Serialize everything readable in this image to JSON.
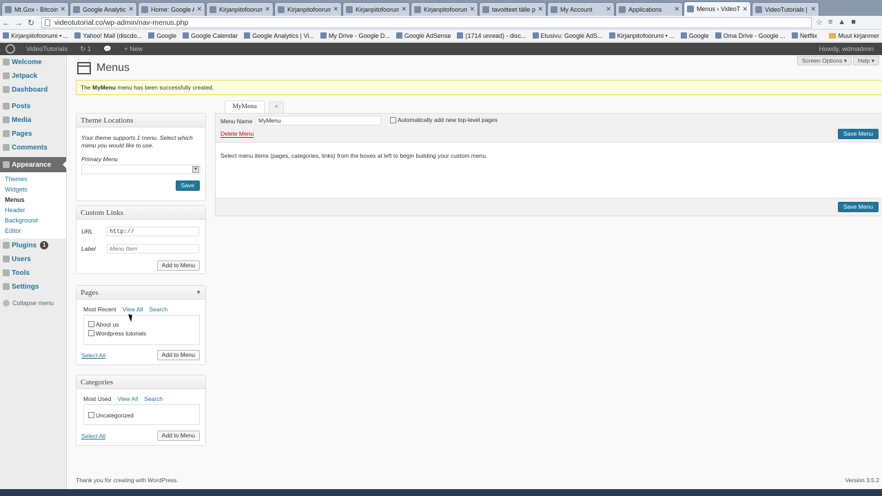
{
  "browser": {
    "tabs": [
      {
        "label": "Mt.Gox - Bitcoin",
        "active": false
      },
      {
        "label": "Google Analytics",
        "active": false
      },
      {
        "label": "Home: Google A",
        "active": false
      },
      {
        "label": "Kirjanpitofoorum",
        "active": false
      },
      {
        "label": "Kirjanpitofoorum",
        "active": false
      },
      {
        "label": "Kirjanpitofoorum",
        "active": false
      },
      {
        "label": "Kirjanpitofoorum",
        "active": false
      },
      {
        "label": "tavoitteet tälle pa",
        "active": false
      },
      {
        "label": "My Account",
        "active": false
      },
      {
        "label": "Applications",
        "active": false
      },
      {
        "label": "Menus ‹ VideoTu",
        "active": true
      },
      {
        "label": "VideoTutorials | J",
        "active": false
      }
    ],
    "url": "videotutorial.co/wp-admin/nav-menus.php",
    "bookmarks": [
      "Kirjanpitofoorumi • ...",
      "Yahoo! Mail (discdo...",
      "Google",
      "Google Calendar",
      "Google Analytics | Vi...",
      "My Drive - Google D...",
      "Google AdSense",
      "(1714 unread) - disc...",
      "Etusivu: Google AdS...",
      "Kirjanpitofoorumi • ...",
      "Google",
      "Oma Drive - Google ...",
      "Netflix"
    ],
    "bookmarks_folder": "Muut kirjanmer"
  },
  "adminbar": {
    "site": "VideoTutorials",
    "updates": "1",
    "new": "+ New",
    "howdy": "Howdy, wdmadmin"
  },
  "sidebar": {
    "items": [
      {
        "label": "Welcome"
      },
      {
        "label": "Jetpack"
      },
      {
        "label": "Dashboard"
      },
      {
        "label": "Posts"
      },
      {
        "label": "Media"
      },
      {
        "label": "Pages"
      },
      {
        "label": "Comments"
      },
      {
        "label": "Appearance"
      },
      {
        "label": "Plugins"
      },
      {
        "label": "Users"
      },
      {
        "label": "Tools"
      },
      {
        "label": "Settings"
      }
    ],
    "appearance_sub": [
      "Themes",
      "Widgets",
      "Menus",
      "Header",
      "Background",
      "Editor"
    ],
    "plugins_badge": "1",
    "collapse": "Collapse menu"
  },
  "header": {
    "screen_options": "Screen Options ▾",
    "help": "Help ▾",
    "title": "Menus"
  },
  "notice": {
    "pre": "The ",
    "menu": "MyMenu",
    "post": " menu has been successfully created."
  },
  "theme_locations": {
    "title": "Theme Locations",
    "desc": "Your theme supports 1 menu. Select which menu you would like to use.",
    "primary_label": "Primary Menu",
    "save": "Save"
  },
  "custom_links": {
    "title": "Custom Links",
    "url_label": "URL",
    "url_value": "http://",
    "label_label": "Label",
    "label_placeholder": "Menu Item",
    "add": "Add to Menu"
  },
  "pages": {
    "title": "Pages",
    "tabs": [
      "Most Recent",
      "View All",
      "Search"
    ],
    "items": [
      "About us",
      "Wordpress tutorials"
    ],
    "select_all": "Select All",
    "add": "Add to Menu"
  },
  "categories": {
    "title": "Categories",
    "tabs": [
      "Most Used",
      "View All",
      "Search"
    ],
    "items": [
      "Uncategorized"
    ],
    "select_all": "Select All",
    "add": "Add to Menu"
  },
  "menu_edit": {
    "tab_label": "MyMenu",
    "add_tab": "+",
    "name_label": "Menu Name",
    "name_value": "MyMenu",
    "auto_add": "Automatically add new top-level pages",
    "delete": "Delete Menu",
    "save": "Save Menu",
    "instructions": "Select menu items (pages, categories, links) from the boxes at left to begin building your custom menu."
  },
  "footer": {
    "thanks": "Thank you for creating with WordPress.",
    "version": "Version 3.5.2"
  }
}
